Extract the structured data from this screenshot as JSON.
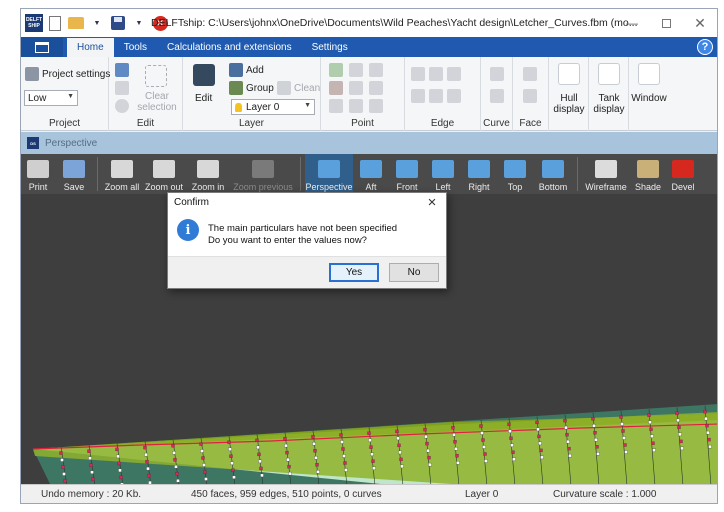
{
  "window": {
    "title": "DELFTship: C:\\Users\\johnx\\OneDrive\\Documents\\Wild Peaches\\Yacht design\\Letcher_Curves.fbm (mo...",
    "logo_text": "DELFT SHIP"
  },
  "ribbon": {
    "tabs": [
      "Home",
      "Tools",
      "Calculations and extensions",
      "Settings"
    ],
    "help_label": "?",
    "project": {
      "settings_label": "Project settings",
      "precision_value": "Low",
      "group_label": "Project"
    },
    "edit": {
      "clear_selection_label": "Clear selection",
      "group_label": "Edit"
    },
    "layer": {
      "edit_label": "Edit",
      "add_label": "Add",
      "group_label_btn": "Group",
      "clean_label": "Clean",
      "active_layer_value": "Layer 0",
      "group_label": "Layer"
    },
    "point": {
      "group_label": "Point"
    },
    "edge": {
      "group_label": "Edge"
    },
    "curve": {
      "group_label": "Curve"
    },
    "face": {
      "group_label": "Face"
    },
    "hull_display_label": "Hull display",
    "tank_display_label": "Tank display",
    "window_label": "Window"
  },
  "viewport": {
    "title": "Perspective",
    "toolbar": [
      {
        "label": "Print",
        "color": "#cfcfcf"
      },
      {
        "label": "Save",
        "color": "#7da4d8"
      },
      {
        "label": "Zoom all",
        "color": "#d8d8d8"
      },
      {
        "label": "Zoom out",
        "color": "#d8d8d8"
      },
      {
        "label": "Zoom in",
        "color": "#d8d8d8"
      },
      {
        "label": "Zoom previous",
        "color": "#7a7a7a"
      },
      {
        "label": "Perspective",
        "color": "#5aa0dc"
      },
      {
        "label": "Aft",
        "color": "#5aa0dc"
      },
      {
        "label": "Front",
        "color": "#5aa0dc"
      },
      {
        "label": "Left",
        "color": "#5aa0dc"
      },
      {
        "label": "Right",
        "color": "#5aa0dc"
      },
      {
        "label": "Top",
        "color": "#5aa0dc"
      },
      {
        "label": "Bottom",
        "color": "#5aa0dc"
      },
      {
        "label": "Wireframe",
        "color": "#dcdcdc"
      },
      {
        "label": "Shade",
        "color": "#c9b079"
      },
      {
        "label": "Devel",
        "color": "#d6281f"
      }
    ]
  },
  "statusbar": {
    "undo_memory": "Undo memory : 20 Kb.",
    "geometry": "450 faces, 959 edges, 510 points, 0 curves",
    "layer": "Layer 0",
    "curvature_scale": "Curvature scale : 1.000"
  },
  "dialog": {
    "title": "Confirm",
    "line1": "The main particulars have not been specified",
    "line2": "Do you want to enter the values now?",
    "yes_label": "Yes",
    "no_label": "No",
    "close_label": "×"
  },
  "colors": {
    "ribbon_tab_bar": "#1f5ab0",
    "view_toolbar": "#4a4a4a",
    "canvas_bg": "#3e3e3e",
    "hull_green": "#7fa020",
    "hull_mint": "#bfe6c8",
    "control_point": "#e0245a"
  }
}
